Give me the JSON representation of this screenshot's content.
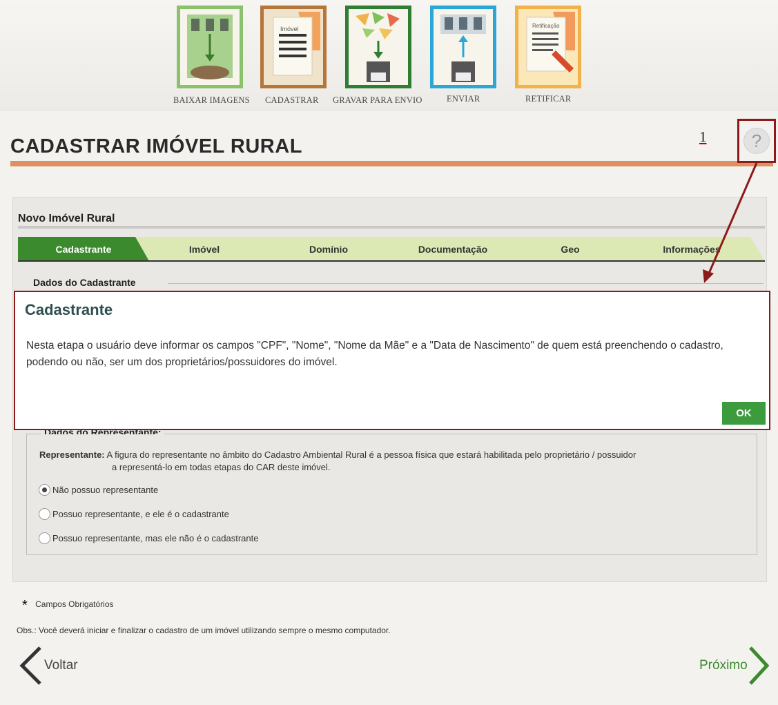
{
  "toolbar": {
    "items": [
      {
        "label": "BAIXAR IMAGENS",
        "icon": "download-images-icon",
        "color": "#8ac16b"
      },
      {
        "label": "CADASTRAR",
        "icon": "register-property-icon",
        "color": "#b5763c"
      },
      {
        "label": "GRAVAR PARA ENVIO",
        "icon": "save-for-sending-icon",
        "color": "#2e7d32"
      },
      {
        "label": "ENVIAR",
        "icon": "send-icon",
        "color": "#2aa7d6"
      },
      {
        "label": "RETIFICAR",
        "icon": "rectify-icon",
        "color": "#f2b24a"
      }
    ],
    "imovel_caption": "Imóvel",
    "retificacao_caption": "Retificação"
  },
  "page": {
    "title": "CADASTRAR IMÓVEL RURAL",
    "annotation_number": "1",
    "help_symbol": "?"
  },
  "form": {
    "title": "Novo Imóvel Rural",
    "tabs": [
      "Cadastrante",
      "Imóvel",
      "Domínio",
      "Documentação",
      "Geo",
      "Informações"
    ],
    "active_tab": "Cadastrante",
    "section_title": "Dados do Cadastrante"
  },
  "modal": {
    "title": "Cadastrante",
    "body": "Nesta etapa o usuário deve informar os campos \"CPF\", \"Nome\", \"Nome da Mãe\" e a \"Data de Nascimento\" de quem está preenchendo o cadastro, podendo ou não, ser um dos proprietários/possuidores do imóvel.",
    "ok_label": "OK"
  },
  "representative": {
    "legend": "Dados do Representante:",
    "label": "Representante:",
    "description_line1": "A figura do representante no âmbito do Cadastro Ambiental Rural é a pessoa física que estará habilitada pelo proprietário / possuidor",
    "description_line2": "a representá-lo em todas etapas do CAR deste imóvel.",
    "options": [
      "Não possuo representante",
      "Possuo representante, e ele é o cadastrante",
      "Possuo representante, mas ele não é o cadastrante"
    ],
    "selected_index": 0
  },
  "footer": {
    "required_star": "*",
    "required_text": "Campos Obrigatórios",
    "obs": "Obs.: Você deverá iniciar e finalizar o cadastro de um imóvel utilizando sempre o mesmo computador.",
    "back_label": "Voltar",
    "next_label": "Próximo"
  },
  "colors": {
    "accent_orange": "#de9060",
    "active_tab": "#3c8a2e",
    "tab": "#dce9b4",
    "annotation": "#8b1a1a",
    "ok_button": "#3c9b3c"
  }
}
